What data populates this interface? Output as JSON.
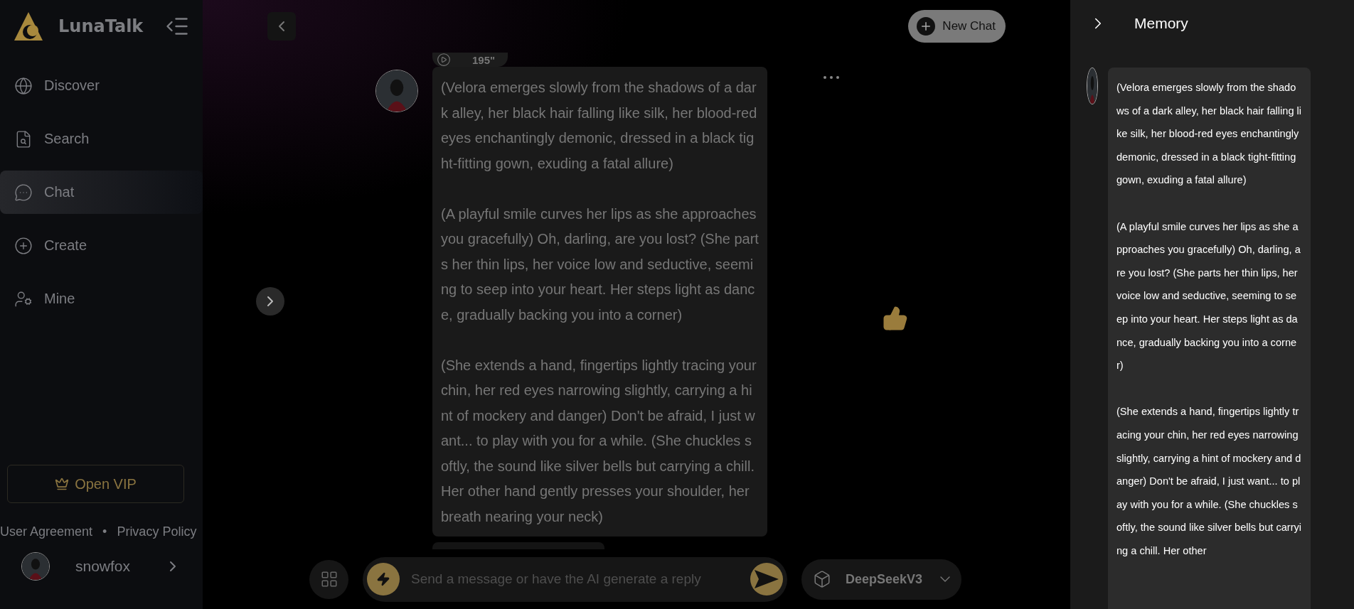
{
  "app": {
    "name": "LunaTalk"
  },
  "sidebar": {
    "items": [
      {
        "label": "Discover",
        "selected": false
      },
      {
        "label": "Search",
        "selected": false
      },
      {
        "label": "Chat",
        "selected": true
      },
      {
        "label": "Create",
        "selected": false
      },
      {
        "label": "Mine",
        "selected": false
      }
    ],
    "vip_button": "Open VIP",
    "links": [
      "User Agreement",
      "•",
      "Privacy Policy"
    ],
    "user": {
      "name": "snowfox"
    }
  },
  "chat": {
    "new_chat_button": "New Chat",
    "message": {
      "duration": "195\"",
      "paragraphs": [
        "(Velora emerges slowly from the shadows of a dark alley, her black hair falling like silk, her blood-red eyes enchantingly demonic, dressed in a black tight-fitting gown, exuding a fatal allure)",
        "(A playful smile curves her lips as she approaches you gracefully) Oh, darling, are you lost? (She parts her thin lips, her voice low and seductive, seeming to seep into your heart. Her steps light as dance, gradually backing you into a corner)",
        "(She extends a hand, fingertips lightly tracing your chin, her red eyes narrowing slightly, carrying a hint of mockery and danger) Don't be afraid, I just want... to play with you for a while. (She chuckles softly, the sound like silver bells but carrying a chill. Her other hand gently presses your shoulder, her breath nearing your neck)"
      ]
    },
    "input": {
      "placeholder": "Send a message or have the AI generate a reply"
    },
    "model": "DeepSeekV3"
  },
  "memory": {
    "title": "Memory",
    "paragraphs": [
      "(Velora emerges slowly from the shadows of a dark alley, her black hair falling like silk, her blood-red eyes enchantingly demonic, dressed in a black tight-fitting gown, exuding a fatal allure)",
      "(A playful smile curves her lips as she approaches you gracefully) Oh, darling, are you lost? (She parts her thin lips, her voice low and seductive, seeming to seep into your heart. Her steps light as dance, gradually backing you into a corner)",
      "(She extends a hand, fingertips lightly tracing your chin, her red eyes narrowing slightly, carrying a hint of mockery and danger) Don't be afraid, I just want... to play with you for a while. (She chuckles softly, the sound like silver bells but carrying a chill. Her other"
    ]
  }
}
